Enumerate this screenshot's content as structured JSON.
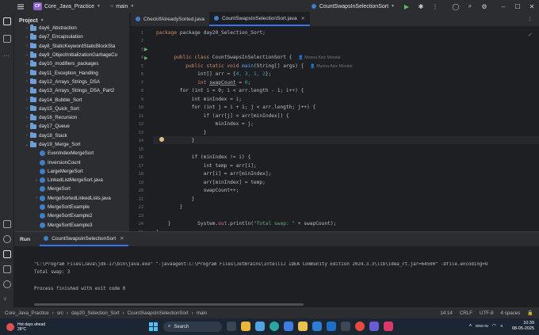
{
  "titlebar": {
    "project_badge": "CP",
    "project_name": "Core_Java_Practice",
    "branch": "main",
    "run_config": "CountSwapsInSelectionSort"
  },
  "project_panel": {
    "title": "Project",
    "items": [
      {
        "label": "day6_Abstraction",
        "type": "folder",
        "indent": 1,
        "arrow": "›"
      },
      {
        "label": "day7_Encapsulation",
        "type": "folder",
        "indent": 1,
        "arrow": "›"
      },
      {
        "label": "day8_StaticKeywordStaticBlockSta",
        "type": "folder",
        "indent": 1,
        "arrow": "›"
      },
      {
        "label": "day9_ObjectInitializationGarbageCo",
        "type": "folder",
        "indent": 1,
        "arrow": "›"
      },
      {
        "label": "day10_modifiers_packages",
        "type": "folder",
        "indent": 1,
        "arrow": "›"
      },
      {
        "label": "day11_Exception_Handling",
        "type": "folder",
        "indent": 1,
        "arrow": "›"
      },
      {
        "label": "day12_Arrays_Strings_DSA",
        "type": "folder",
        "indent": 1,
        "arrow": "›"
      },
      {
        "label": "day13_Arrays_Strings_DSA_Part2",
        "type": "folder",
        "indent": 1,
        "arrow": "›"
      },
      {
        "label": "day14_Bubble_Sort",
        "type": "folder",
        "indent": 1,
        "arrow": "›"
      },
      {
        "label": "day15_Quick_Sort",
        "type": "folder",
        "indent": 1,
        "arrow": "›"
      },
      {
        "label": "day16_Recursion",
        "type": "folder",
        "indent": 1,
        "arrow": "›"
      },
      {
        "label": "day17_Queue",
        "type": "folder",
        "indent": 1,
        "arrow": "›"
      },
      {
        "label": "day18_Stack",
        "type": "folder",
        "indent": 1,
        "arrow": "›"
      },
      {
        "label": "day19_Merge_Sort",
        "type": "folder",
        "indent": 1,
        "arrow": "⌄"
      },
      {
        "label": "EvenIndexMergeSort",
        "type": "class",
        "indent": 2,
        "arrow": ""
      },
      {
        "label": "InversionCount",
        "type": "class",
        "indent": 2,
        "arrow": ""
      },
      {
        "label": "LargeMergeSort",
        "type": "class",
        "indent": 2,
        "arrow": ""
      },
      {
        "label": "LinkedListMergeSort.java",
        "type": "class",
        "indent": 2,
        "arrow": "›"
      },
      {
        "label": "MergeSort",
        "type": "class",
        "indent": 2,
        "arrow": ""
      },
      {
        "label": "MergeSortedLinkedLists.java",
        "type": "class",
        "indent": 2,
        "arrow": "›"
      },
      {
        "label": "MergeSortExample",
        "type": "class",
        "indent": 2,
        "arrow": ""
      },
      {
        "label": "MergeSortExample2",
        "type": "class",
        "indent": 2,
        "arrow": ""
      },
      {
        "label": "MergeSortExample3",
        "type": "class",
        "indent": 2,
        "arrow": ""
      }
    ]
  },
  "tabs": [
    {
      "label": "CheckIfAlreadySorted.java",
      "active": false
    },
    {
      "label": "CountSwapsInSelectionSort.java",
      "active": true
    }
  ],
  "editor": {
    "line_numbers": [
      "1",
      "2",
      "3",
      "4",
      "5",
      "6",
      "7",
      "8",
      "9",
      "10",
      "11",
      "12",
      "13",
      "14",
      "15",
      "16",
      "17",
      "18",
      "19",
      "20",
      "21",
      "22",
      "23",
      "24",
      "25",
      "26",
      "27"
    ],
    "author_hint": "Munna Aziz Mondal",
    "lines": {
      "l1": "package day20_Selection_Sort;",
      "l3a": "public class ",
      "l3b": "CountSwapsInSelectionSort",
      "l3c": " {",
      "l4a": "    public static void ",
      "l4b": "main",
      "l4c": "(String[] args) {",
      "l5a": "        int[] arr = {",
      "l5b": "4, 3, 1, 2",
      "l5c": "};",
      "l6a": "        int ",
      "l6b": "swapCount",
      "l6c": " = ",
      "l6d": "0",
      "l6e": ";",
      "l8": "        for (int i = 0; i < arr.length - 1; i++) {",
      "l9": "            int minIndex = i;",
      "l10": "            for (int j = i + 1; j < arr.length; j++) {",
      "l11": "                if (arr[j] < arr[minIndex]) {",
      "l12": "                    minIndex = j;",
      "l13": "                }",
      "l14": "            }",
      "l16": "            if (minIndex != i) {",
      "l17": "                int temp = arr[i];",
      "l18": "                arr[i] = arr[minIndex];",
      "l19": "                arr[minIndex] = temp;",
      "l20": "                swapCount++;",
      "l21": "            }",
      "l22": "        }",
      "l23a": "        System.",
      "l23b": "out",
      "l23c": ".println(",
      "l23d": "\"Total swap: \"",
      "l23e": " + swapCount);",
      "l24": "    }",
      "l25": "}"
    }
  },
  "run_panel": {
    "title": "Run",
    "tab_label": "CountSwapsInSelectionSort",
    "command": "\"C:\\Program Files\\Java\\jdk-17\\bin\\java.exe\" \"-javaagent:C:\\Program Files\\JetBrains\\IntelliJ IDEA Community Edition 2024.3.3\\lib\\idea_rt.jar=64500\" -Dfile.encoding=U",
    "output": "Total swap: 3",
    "exit": "Process finished with exit code 0"
  },
  "statusbar": {
    "breadcrumb": [
      "Core_Java_Practice",
      "src",
      "day20_Selection_Sort",
      "CountSwapsInSelectionSort",
      "main"
    ],
    "position": "14:14",
    "line_sep": "CRLF",
    "encoding": "UTF-8",
    "indent": "4 spaces"
  },
  "taskbar": {
    "weather_title": "Hot days ahead",
    "weather_temp": "28°C",
    "search_label": "Search",
    "time": "10:39",
    "date": "08-05-2025",
    "lang": "ENG IN"
  }
}
